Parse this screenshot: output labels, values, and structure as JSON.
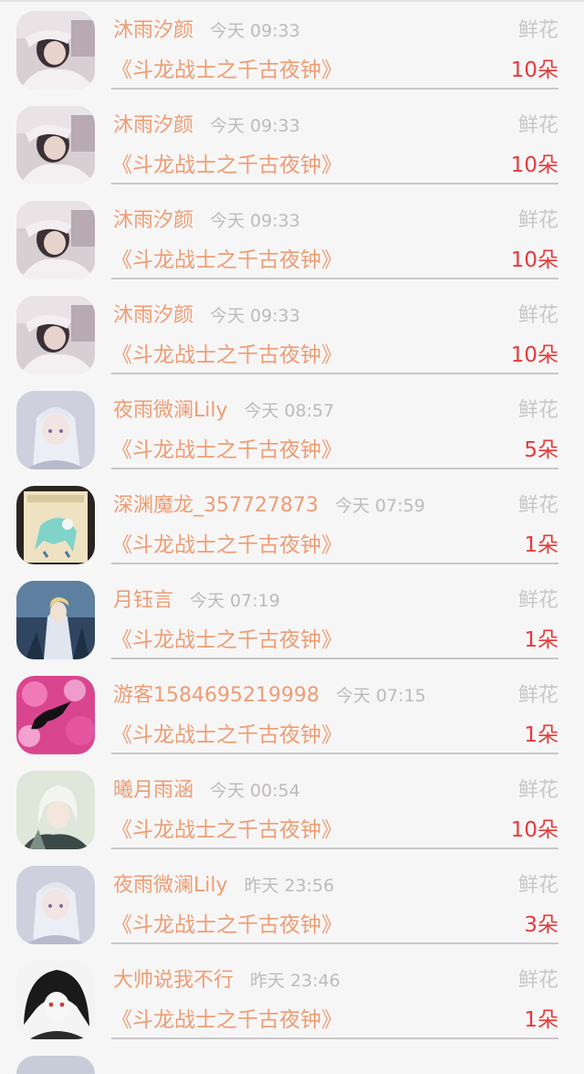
{
  "gift_label": "鲜花",
  "rows": [
    {
      "name": "沐雨汐颜",
      "time": "今天 09:33",
      "book": "《斗龙战士之千古夜钟》",
      "count": "10朵",
      "avatar": "avatar-girl-photo"
    },
    {
      "name": "沐雨汐颜",
      "time": "今天 09:33",
      "book": "《斗龙战士之千古夜钟》",
      "count": "10朵",
      "avatar": "avatar-girl-photo"
    },
    {
      "name": "沐雨汐颜",
      "time": "今天 09:33",
      "book": "《斗龙战士之千古夜钟》",
      "count": "10朵",
      "avatar": "avatar-girl-photo"
    },
    {
      "name": "沐雨汐颜",
      "time": "今天 09:33",
      "book": "《斗龙战士之千古夜钟》",
      "count": "10朵",
      "avatar": "avatar-girl-photo"
    },
    {
      "name": "夜雨微澜Lily",
      "time": "今天 08:57",
      "book": "《斗龙战士之千古夜钟》",
      "count": "5朵",
      "avatar": "avatar-anime-silver"
    },
    {
      "name": "深渊魔龙_357727873",
      "time": "今天 07:59",
      "book": "《斗龙战士之千古夜钟》",
      "count": "1朵",
      "avatar": "avatar-card-beast"
    },
    {
      "name": "月钰言",
      "time": "今天 07:19",
      "book": "《斗龙战士之千古夜钟》",
      "count": "1朵",
      "avatar": "avatar-anime-knight"
    },
    {
      "name": "游客1584695219998",
      "time": "今天 07:15",
      "book": "《斗龙战士之千古夜钟》",
      "count": "1朵",
      "avatar": "avatar-pink-flowers"
    },
    {
      "name": "曦月雨涵",
      "time": "今天 00:54",
      "book": "《斗龙战士之千古夜钟》",
      "count": "10朵",
      "avatar": "avatar-anime-boy"
    },
    {
      "name": "夜雨微澜Lily",
      "time": "昨天 23:56",
      "book": "《斗龙战士之千古夜钟》",
      "count": "3朵",
      "avatar": "avatar-anime-silver"
    },
    {
      "name": "大帅说我不行",
      "time": "昨天 23:46",
      "book": "《斗龙战士之千古夜钟》",
      "count": "1朵",
      "avatar": "avatar-bw-sketch"
    }
  ]
}
